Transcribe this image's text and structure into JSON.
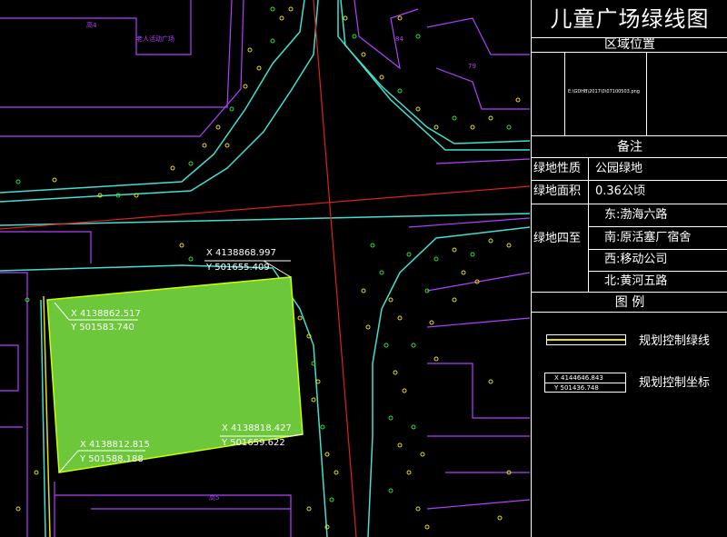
{
  "panel": {
    "title": "儿童广场绿线图",
    "location_header": "区域位置",
    "location_image_text": "E:\\GDHB\\2017\\0\\07100503.png",
    "remarks_header": "备注",
    "attributes": [
      {
        "key": "绿地性质",
        "value": "公园绿地"
      },
      {
        "key": "绿地面积",
        "value": "0.36公顷"
      }
    ],
    "boundary_key": "绿地四至",
    "boundaries": [
      "东:渤海六路",
      "南:原活塞厂宿舍",
      "西:移动公司",
      "北:黄河五路"
    ],
    "legend_header": "图    例",
    "legend": {
      "line_label": "规划控制绿线",
      "coord_label": "规划控制坐标",
      "coord_sample_x": "X 4144646.843",
      "coord_sample_y": "Y 501436.748"
    }
  },
  "map": {
    "labels": {
      "top_left_building": "高4",
      "square_name": "老人活动广场",
      "block_79": "79",
      "block_84": "84",
      "bottom_building": "高5"
    },
    "coordinates": [
      {
        "x": "X 4138868.997",
        "y": "Y 501655.409"
      },
      {
        "x": "X 4138862.517",
        "y": "Y 501583.740"
      },
      {
        "x": "X 4138818.427",
        "y": "Y 501659.622"
      },
      {
        "x": "X 4138812.815",
        "y": "Y 501588.188"
      }
    ],
    "colors": {
      "green_area": "#6cc83a",
      "road_edge": "#40e0d0",
      "building_line": "#b040ff",
      "center_line": "#e02020",
      "tree": "#e8e000",
      "tree_alt": "#30e030"
    }
  }
}
